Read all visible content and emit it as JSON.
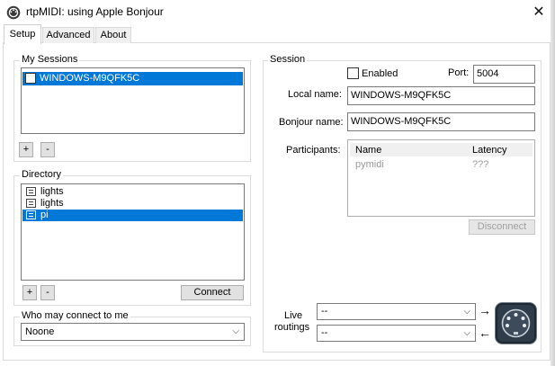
{
  "window": {
    "title": "rtpMIDI: using Apple Bonjour",
    "close_glyph": "✕"
  },
  "tabs": [
    {
      "label": "Setup"
    },
    {
      "label": "Advanced"
    },
    {
      "label": "About"
    }
  ],
  "my_sessions": {
    "label": "My Sessions",
    "items": [
      {
        "name": "WINDOWS-M9QFK5C",
        "enabled": false,
        "selected": true
      }
    ],
    "add_label": "+",
    "remove_label": "-"
  },
  "directory": {
    "label": "Directory",
    "items": [
      {
        "name": "lights",
        "selected": false
      },
      {
        "name": "lights",
        "selected": false
      },
      {
        "name": "pi",
        "selected": true
      }
    ],
    "add_label": "+",
    "remove_label": "-",
    "connect_label": "Connect"
  },
  "who_may_connect": {
    "label": "Who may connect to me",
    "value": "Noone"
  },
  "session": {
    "label": "Session",
    "enabled_label": "Enabled",
    "enabled": false,
    "port_label": "Port:",
    "port_value": "5004",
    "local_name_label": "Local name:",
    "local_name_value": "WINDOWS-M9QFK5C",
    "bonjour_name_label": "Bonjour name:",
    "bonjour_name_value": "WINDOWS-M9QFK5C",
    "participants_label": "Participants:",
    "participants_columns": {
      "name": "Name",
      "latency": "Latency"
    },
    "participants": [
      {
        "name": "pymidi",
        "latency": "???"
      }
    ],
    "disconnect_label": "Disconnect",
    "live_routings_label_line1": "Live",
    "live_routings_label_line2": "routings",
    "routing_in_value": "--",
    "routing_out_value": "--",
    "arrow_right": "→",
    "arrow_left": "←"
  },
  "colors": {
    "selection": "#0078d7",
    "midi_icon": "#2f3c4a"
  }
}
